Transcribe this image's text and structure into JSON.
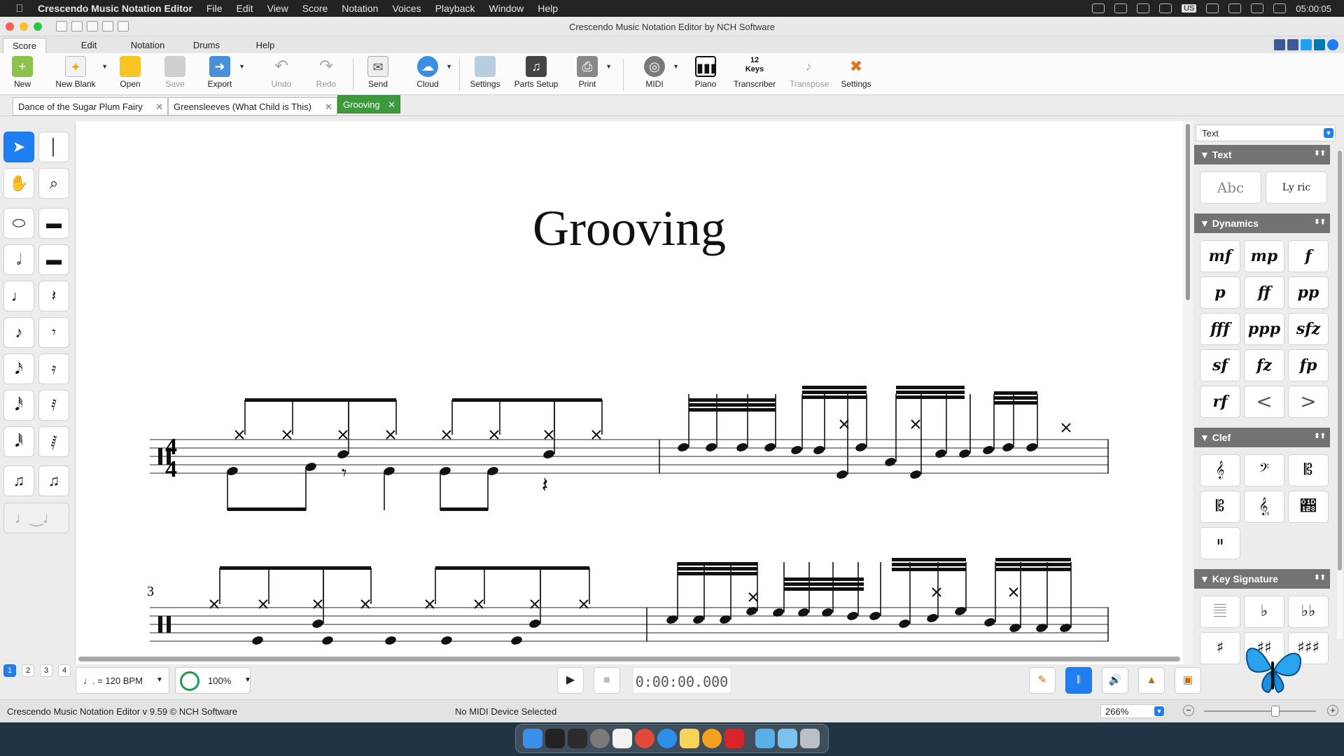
{
  "os_menubar": {
    "app_name": "Crescendo Music Notation Editor",
    "items": [
      "File",
      "Edit",
      "View",
      "Score",
      "Notation",
      "Voices",
      "Playback",
      "Window",
      "Help"
    ],
    "clock": "05:00:05",
    "input_source": "US"
  },
  "window": {
    "title": "Crescendo Music Notation Editor by NCH Software"
  },
  "ribbon_tabs": [
    "Score",
    "Edit",
    "Notation",
    "Drums",
    "Help"
  ],
  "active_ribbon_tab": "Score",
  "toolbar": {
    "new": "New",
    "new_blank": "New Blank",
    "open": "Open",
    "save": "Save",
    "export": "Export",
    "undo": "Undo",
    "redo": "Redo",
    "send": "Send",
    "cloud": "Cloud",
    "settings": "Settings",
    "parts_setup": "Parts Setup",
    "print": "Print",
    "midi": "MIDI",
    "piano": "Piano",
    "transcriber": "Transcriber",
    "transcriber_badge_top": "12",
    "transcriber_badge_bottom": "Keys",
    "transpose": "Transpose",
    "settings2": "Settings"
  },
  "doc_tabs": [
    {
      "label": "Dance of the Sugar Plum Fairy"
    },
    {
      "label": "Greensleeves (What Child is This)"
    },
    {
      "label": "Grooving"
    }
  ],
  "score": {
    "title": "Grooving",
    "system2_measure_number": "3",
    "time_signature_top": "4",
    "time_signature_bottom": "4"
  },
  "voices": [
    "1",
    "2",
    "3",
    "4"
  ],
  "right_panel": {
    "dropdown_value": "Text",
    "sections": {
      "text": "Text",
      "dynamics": "Dynamics",
      "clef": "Clef",
      "key_signature": "Key Signature"
    },
    "text_buttons": [
      "Abc",
      "Ly ric"
    ],
    "dynamics": [
      "mf",
      "mp",
      "f",
      "p",
      "ff",
      "pp",
      "fff",
      "ppp",
      "sfz",
      "sf",
      "fz",
      "fp",
      "rf",
      "<",
      ">"
    ]
  },
  "transport": {
    "tempo": "= 120 BPM",
    "speed": "100%",
    "time": "0:00:00.000"
  },
  "statusbar": {
    "left_text": "Crescendo Music Notation Editor v 9.59 © NCH Software",
    "midi_status": "No MIDI Device Selected",
    "zoom": "266%"
  },
  "colors": {
    "accent_blue": "#1f7ff0",
    "active_doc_tab": "#3c9a3c"
  }
}
